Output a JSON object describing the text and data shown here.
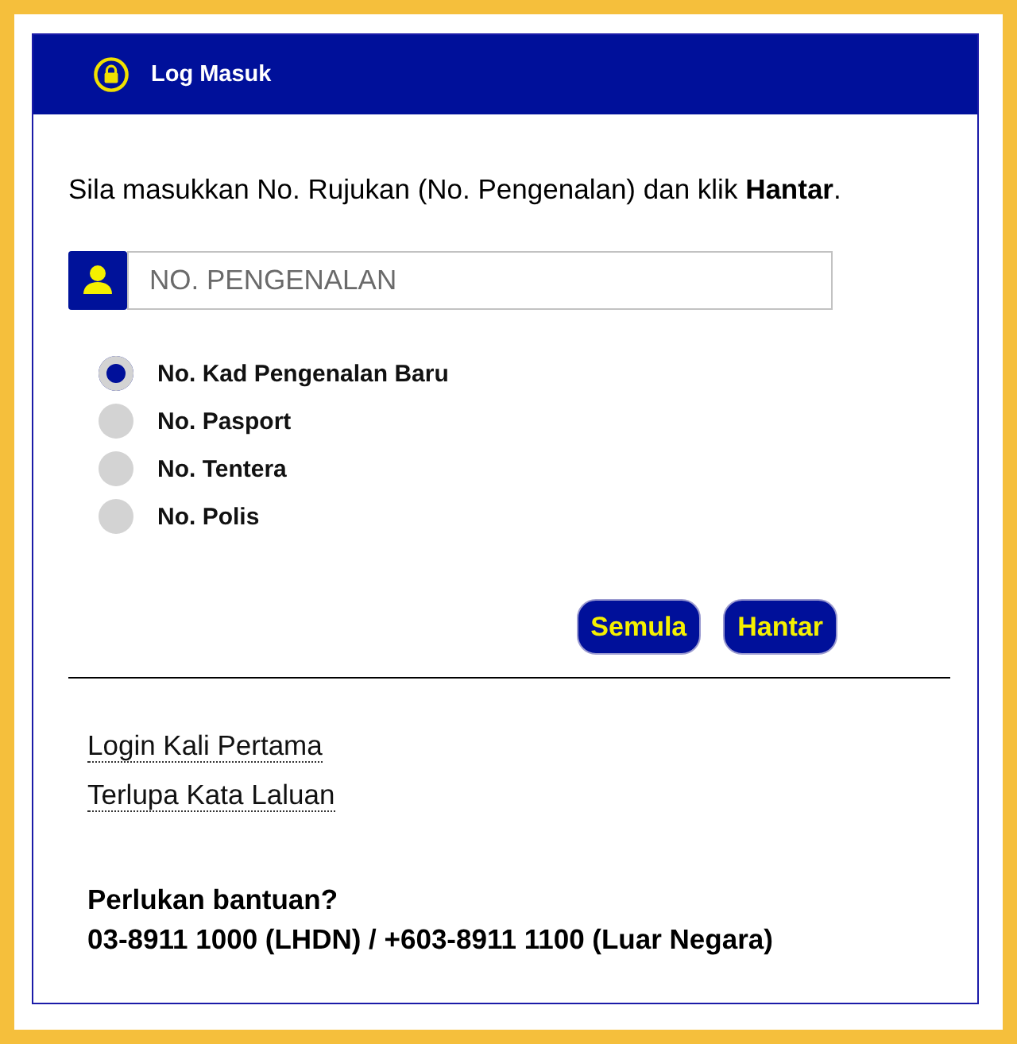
{
  "header": {
    "title": "Log Masuk"
  },
  "instruction": "Sila masukkan No. Rujukan (No. Pengenalan) dan klik **Hantar**.",
  "id_field": {
    "placeholder": "NO. PENGENALAN"
  },
  "id_types": [
    {
      "label": "No. Kad Pengenalan Baru",
      "selected": true
    },
    {
      "label": "No. Pasport",
      "selected": false
    },
    {
      "label": "No. Tentera",
      "selected": false
    },
    {
      "label": "No. Polis",
      "selected": false
    }
  ],
  "buttons": [
    "Semula",
    "Hantar"
  ],
  "links": [
    "Login Kali Pertama",
    "Terlupa Kata Laluan"
  ],
  "help": {
    "title": "Perlukan bantuan?",
    "phone": "03-8911 1000 (LHDN) / +603-8911 1100 (Luar Negara)"
  }
}
